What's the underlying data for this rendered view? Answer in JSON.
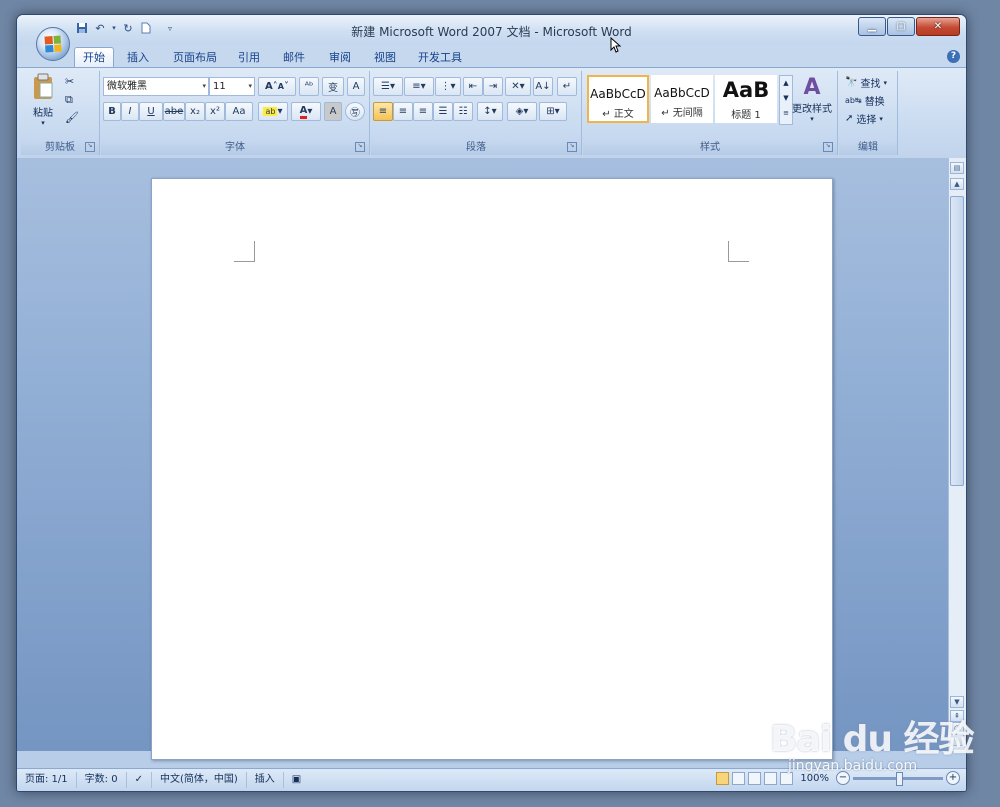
{
  "window": {
    "title": "新建 Microsoft Word 2007 文档 - Microsoft Word"
  },
  "tabs": [
    "开始",
    "插入",
    "页面布局",
    "引用",
    "邮件",
    "审阅",
    "视图",
    "开发工具"
  ],
  "clipboard": {
    "paste_label": "粘贴",
    "group_label": "剪贴板"
  },
  "font": {
    "family": "微软雅黑",
    "size": "11",
    "group_label": "字体",
    "buttons": [
      "B",
      "I",
      "U",
      "abe",
      "x₂",
      "x²",
      "Aa",
      "A",
      "A"
    ]
  },
  "paragraph": {
    "group_label": "段落"
  },
  "styles": {
    "group_label": "样式",
    "items": [
      {
        "preview": "AaBbCcD",
        "name": "↵ 正文"
      },
      {
        "preview": "AaBbCcD",
        "name": "↵ 无间隔"
      },
      {
        "preview": "AaB",
        "name": "标题 1"
      }
    ],
    "change_label": "更改样式"
  },
  "editing": {
    "group_label": "编辑",
    "find": "查找",
    "replace": "替换",
    "select": "选择"
  },
  "statusbar": {
    "page": "页面: 1/1",
    "words": "字数: 0",
    "language": "中文(简体，中国)",
    "mode": "插入",
    "zoom": "100%"
  },
  "watermark": {
    "brand": "Bai du 经验",
    "url": "jingyan.baidu.com"
  }
}
